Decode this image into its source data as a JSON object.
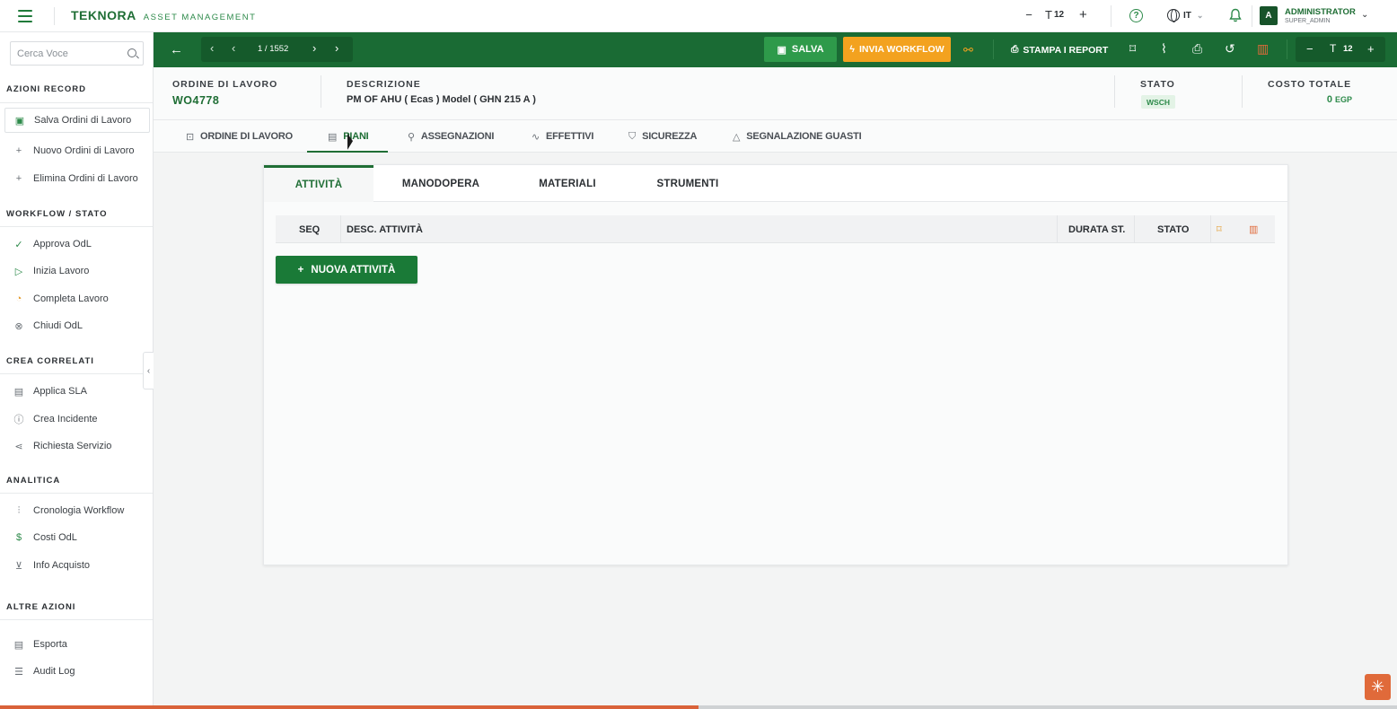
{
  "brand": {
    "name": "TEKNORA",
    "subtitle": "ASSET MANAGEMENT"
  },
  "top_bar": {
    "font_size": "12",
    "language": "IT",
    "avatar_letter": "A",
    "user_name": "ADMINISTRATOR",
    "user_role": "SUPER_ADMIN",
    "icons": [
      "menu-icon",
      "minus-icon",
      "text-size-icon",
      "plus-icon",
      "help-icon",
      "globe-icon",
      "bell-icon",
      "chevron-down-icon"
    ]
  },
  "sidebar": {
    "search_placeholder": "Cerca Voce",
    "sections": [
      {
        "title": "AZIONI RECORD",
        "items": [
          {
            "label": "Salva Ordini di Lavoro",
            "icon": "save-icon"
          },
          {
            "label": "Nuovo Ordini di Lavoro",
            "icon": "plus-icon"
          },
          {
            "label": "Elimina Ordini di Lavoro",
            "icon": "plus-icon"
          }
        ]
      },
      {
        "title": "WORKFLOW / STATO",
        "items": [
          {
            "label": "Approva OdL",
            "icon": "check-circle-icon"
          },
          {
            "label": "Inizia Lavoro",
            "icon": "play-icon"
          },
          {
            "label": "Completa Lavoro",
            "icon": "clock-icon"
          },
          {
            "label": "Chiudi OdL",
            "icon": "close-circle-icon"
          }
        ]
      },
      {
        "title": "CREA CORRELATI",
        "items": [
          {
            "label": "Applica SLA",
            "icon": "document-icon"
          },
          {
            "label": "Crea Incidente",
            "icon": "alert-circle-icon"
          },
          {
            "label": "Richiesta Servizio",
            "icon": "share-icon"
          }
        ]
      },
      {
        "title": "ANALITICA",
        "items": [
          {
            "label": "Cronologia Workflow",
            "icon": "bar-chart-icon"
          },
          {
            "label": "Costi OdL",
            "icon": "dollar-icon"
          },
          {
            "label": "Info Acquisto",
            "icon": "cart-icon"
          }
        ]
      },
      {
        "title": "ALTRE AZIONI",
        "items": [
          {
            "label": "Esporta",
            "icon": "export-icon"
          },
          {
            "label": "Audit Log",
            "icon": "list-icon"
          }
        ]
      }
    ]
  },
  "toolbar": {
    "pager_text": "1 / 1552",
    "save_label": "SALVA",
    "workflow_label": "INVIA WORKFLOW",
    "print_reports_label": "STAMPA I REPORT",
    "zoom_value": "12",
    "colors": {
      "bar": "#1a6b34",
      "save": "#2e9a4a",
      "workflow": "#f3a21f",
      "delete": "#e06a3a"
    }
  },
  "record": {
    "order_label": "ORDINE DI LAVORO",
    "order_value": "WO4778",
    "description_label": "DESCRIZIONE",
    "description_value": "PM OF AHU   ( Ecas ) Model ( GHN 215 A )",
    "status_label": "STATO",
    "status_value": "WSCH",
    "cost_label": "COSTO TOTALE",
    "cost_value": "0",
    "cost_currency": "EGP"
  },
  "tabs": [
    {
      "label": "ORDINE DI LAVORO",
      "icon": "briefcase-icon"
    },
    {
      "label": "PIANI",
      "icon": "document-icon",
      "active": true
    },
    {
      "label": "ASSEGNAZIONI",
      "icon": "user-icon"
    },
    {
      "label": "EFFETTIVI",
      "icon": "activity-icon"
    },
    {
      "label": "SICUREZZA",
      "icon": "shield-icon"
    },
    {
      "label": "SEGNALAZIONE GUASTI",
      "icon": "warning-icon"
    }
  ],
  "subtabs": [
    {
      "label": "ATTIVITÀ",
      "active": true
    },
    {
      "label": "MANODOPERA"
    },
    {
      "label": "MATERIALI"
    },
    {
      "label": "STRUMENTI"
    }
  ],
  "grid": {
    "columns": [
      "SEQ",
      "DESC. ATTIVITÀ",
      "DURATA ST.",
      "STATO"
    ],
    "rows": [],
    "add_button_label": "NUOVA ATTIVITÀ"
  },
  "progress": {
    "fraction": 0.5
  }
}
